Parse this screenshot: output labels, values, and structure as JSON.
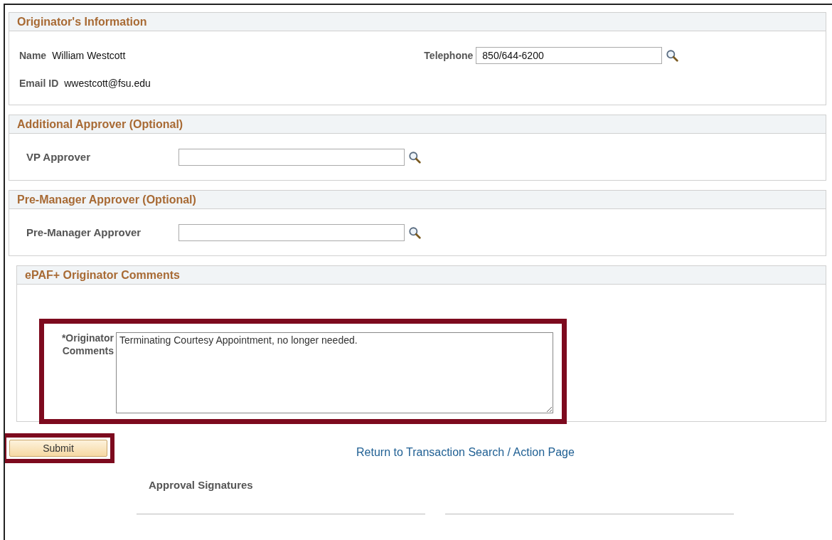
{
  "originator": {
    "title": "Originator's Information",
    "name_label": "Name",
    "name": "William Westcott",
    "telephone_label": "Telephone",
    "telephone": "850/644-6200",
    "email_label": "Email ID",
    "email": "wwestcott@fsu.edu"
  },
  "additional": {
    "title": "Additional Approver (Optional)",
    "label": "VP Approver"
  },
  "pre_manager": {
    "title": "Pre-Manager Approver (Optional)",
    "label": "Pre-Manager Approver"
  },
  "comments": {
    "title": "ePAF+ Originator Comments",
    "label": "*Originator Comments",
    "value": "Terminating Courtesy Appointment, no longer needed.",
    "highlighted": true
  },
  "submit": {
    "label": "Submit",
    "highlighted": true
  },
  "return_link": "Return to Transaction Search / Action Page",
  "approval_title": "Approval Signatures"
}
